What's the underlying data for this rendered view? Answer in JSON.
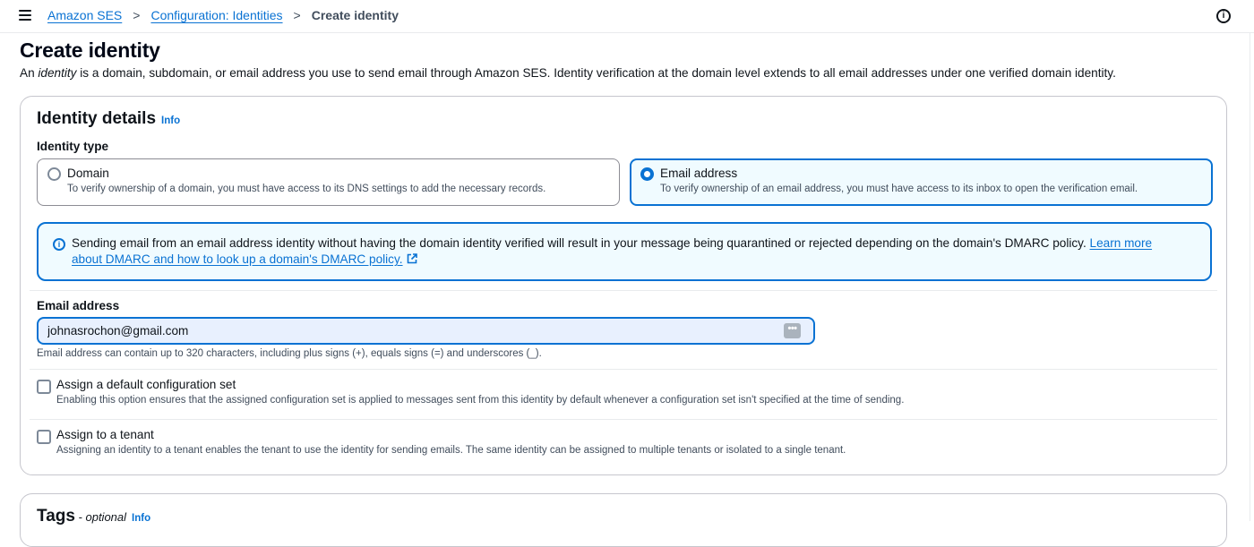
{
  "breadcrumb": {
    "items": [
      "Amazon SES",
      "Configuration: Identities"
    ],
    "separator": ">",
    "current": "Create identity"
  },
  "page": {
    "title": "Create identity",
    "desc_prefix": "An ",
    "desc_emph": "identity",
    "desc_suffix": " is a domain, subdomain, or email address you use to send email through Amazon SES. Identity verification at the domain level extends to all email addresses under one verified domain identity."
  },
  "identity_details": {
    "title": "Identity details",
    "info": "Info",
    "type_label": "Identity type",
    "options": [
      {
        "title": "Domain",
        "desc": "To verify ownership of a domain, you must have access to its DNS settings to add the necessary records.",
        "selected": false
      },
      {
        "title": "Email address",
        "desc": "To verify ownership of an email address, you must have access to its inbox to open the verification email.",
        "selected": true
      }
    ],
    "alert": {
      "text": "Sending email from an email address identity without having the domain identity verified will result in your message being quarantined or rejected depending on the domain's DMARC policy. ",
      "link": "Learn more about DMARC and how to look up a domain's DMARC policy."
    },
    "email": {
      "label": "Email address",
      "value": "johnasrochon@gmail.com",
      "constraint": "Email address can contain up to 320 characters, including plus signs (+), equals signs (=) and underscores (_)."
    },
    "config_set": {
      "label": "Assign a default configuration set",
      "desc": "Enabling this option ensures that the assigned configuration set is applied to messages sent from this identity by default whenever a configuration set isn't specified at the time of sending.",
      "checked": false
    },
    "tenant": {
      "label": "Assign to a tenant",
      "desc": "Assigning an identity to a tenant enables the tenant to use the identity for sending emails. The same identity can be assigned to multiple tenants or isolated to a single tenant.",
      "checked": false
    }
  },
  "tags": {
    "title": "Tags",
    "optional": " - optional",
    "info": "Info"
  },
  "colors": {
    "accent": "#0972d3",
    "alert_bg": "#f0fbff",
    "input_bg": "#e8f0fe",
    "border": "#c6c6cd"
  },
  "icons": [
    "menu-icon",
    "chevron-right-icon",
    "info-circle-icon",
    "external-link-icon",
    "autofill-icon"
  ]
}
